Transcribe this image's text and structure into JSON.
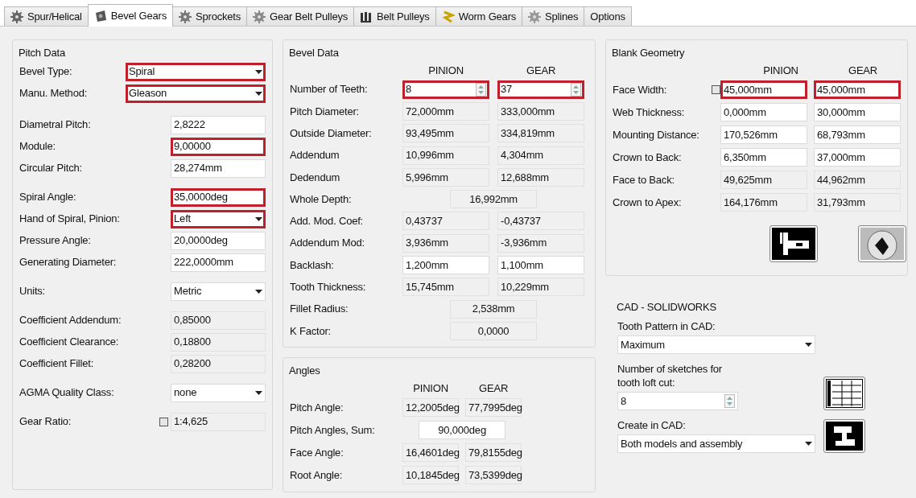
{
  "tabs": [
    {
      "label": "Spur/Helical",
      "selected": false
    },
    {
      "label": "Bevel Gears",
      "selected": true
    },
    {
      "label": "Sprockets",
      "selected": false
    },
    {
      "label": "Gear Belt Pulleys",
      "selected": false
    },
    {
      "label": "Belt Pulleys",
      "selected": false
    },
    {
      "label": "Worm Gears",
      "selected": false
    },
    {
      "label": "Splines",
      "selected": false
    },
    {
      "label": "Options",
      "selected": false
    }
  ],
  "pitch_data": {
    "title": "Pitch Data",
    "sections": [
      [
        {
          "label": "Bevel Type:",
          "field": {
            "kind": "dropdown",
            "value": "Spiral",
            "highlighted": true,
            "wide": true
          }
        },
        {
          "label": "Manu. Method:",
          "field": {
            "kind": "dropdown",
            "value": "Gleason",
            "highlighted": true,
            "wide": true
          }
        }
      ],
      [
        {
          "label": "Diametral Pitch:",
          "field": {
            "kind": "text",
            "value": "2,8222",
            "highlighted": false
          }
        },
        {
          "label": "Module:",
          "field": {
            "kind": "text",
            "value": "9,00000",
            "highlighted": true
          }
        },
        {
          "label": "Circular Pitch:",
          "field": {
            "kind": "text",
            "value": "28,274mm",
            "highlighted": false
          }
        }
      ],
      [
        {
          "label": "Spiral Angle:",
          "field": {
            "kind": "text",
            "value": "35,0000deg",
            "highlighted": true
          }
        },
        {
          "label": "Hand of Spiral, Pinion:",
          "field": {
            "kind": "dropdown",
            "value": "Left",
            "highlighted": true
          }
        },
        {
          "label": "Pressure Angle:",
          "field": {
            "kind": "text",
            "value": "20,0000deg",
            "highlighted": false
          }
        },
        {
          "label": "Generating Diameter:",
          "field": {
            "kind": "text",
            "value": "222,0000mm",
            "highlighted": false
          }
        }
      ],
      [
        {
          "label": "Units:",
          "field": {
            "kind": "dropdown",
            "value": "Metric",
            "highlighted": false
          }
        }
      ],
      [
        {
          "label": "Coefficient Addendum:",
          "field": {
            "kind": "readonly",
            "value": "0,85000",
            "highlighted": false
          }
        },
        {
          "label": "Coefficient Clearance:",
          "field": {
            "kind": "readonly",
            "value": "0,18800",
            "highlighted": false
          }
        },
        {
          "label": "Coefficient Fillet:",
          "field": {
            "kind": "readonly",
            "value": "0,28200",
            "highlighted": false
          }
        }
      ],
      [
        {
          "label": "AGMA Quality Class:",
          "field": {
            "kind": "dropdown",
            "value": "none",
            "highlighted": false
          }
        }
      ],
      [
        {
          "label": "Gear Ratio:",
          "checkbox": {
            "checked": false
          },
          "field": {
            "kind": "readonly",
            "value": "1:4,625",
            "highlighted": false
          }
        }
      ]
    ]
  },
  "bevel_data": {
    "title": "Bevel Data",
    "headers": [
      "PINION",
      "GEAR"
    ],
    "rows": [
      {
        "label": "Number of Teeth:",
        "cells": [
          {
            "kind": "spin",
            "value": "8",
            "highlighted": true
          },
          {
            "kind": "spin",
            "value": "37",
            "highlighted": true
          }
        ]
      },
      {
        "label": "Pitch Diameter:",
        "cells": [
          {
            "kind": "readonly",
            "value": "72,000mm",
            "highlighted": false
          },
          {
            "kind": "readonly",
            "value": "333,000mm",
            "highlighted": false
          }
        ]
      },
      {
        "label": "Outside Diameter:",
        "cells": [
          {
            "kind": "readonly",
            "value": "93,495mm",
            "highlighted": false
          },
          {
            "kind": "readonly",
            "value": "334,819mm",
            "highlighted": false
          }
        ]
      },
      {
        "label": "Addendum",
        "cells": [
          {
            "kind": "readonly",
            "value": "10,996mm",
            "highlighted": false
          },
          {
            "kind": "readonly",
            "value": "4,304mm",
            "highlighted": false
          }
        ]
      },
      {
        "label": "Dedendum",
        "cells": [
          {
            "kind": "readonly",
            "value": "5,996mm",
            "highlighted": false
          },
          {
            "kind": "readonly",
            "value": "12,688mm",
            "highlighted": false
          }
        ]
      },
      {
        "label": "Whole Depth:",
        "cells": [
          {
            "kind": "readonly",
            "value": "16,992mm",
            "highlighted": false
          }
        ]
      },
      {
        "label": "Add. Mod. Coef:",
        "cells": [
          {
            "kind": "readonly",
            "value": "0,43737",
            "highlighted": false
          },
          {
            "kind": "readonly",
            "value": "-0,43737",
            "highlighted": false
          }
        ]
      },
      {
        "label": "Addendum Mod:",
        "cells": [
          {
            "kind": "readonly",
            "value": "3,936mm",
            "highlighted": false
          },
          {
            "kind": "readonly",
            "value": "-3,936mm",
            "highlighted": false
          }
        ]
      },
      {
        "label": "Backlash:",
        "cells": [
          {
            "kind": "text",
            "value": "1,200mm",
            "highlighted": false
          },
          {
            "kind": "text",
            "value": "1,100mm",
            "highlighted": false
          }
        ]
      },
      {
        "label": "Tooth Thickness:",
        "cells": [
          {
            "kind": "readonly",
            "value": "15,745mm",
            "highlighted": false
          },
          {
            "kind": "readonly",
            "value": "10,229mm",
            "highlighted": false
          }
        ]
      },
      {
        "label": "Fillet Radius:",
        "cells": [
          {
            "kind": "readonly",
            "value": "2,538mm",
            "highlighted": false
          }
        ]
      },
      {
        "label": "K Factor:",
        "cells": [
          {
            "kind": "readonly",
            "value": "0,0000",
            "highlighted": false
          }
        ]
      }
    ]
  },
  "angles": {
    "title": "Angles",
    "headers": [
      "PINION",
      "GEAR"
    ],
    "rows": [
      {
        "label": "Pitch Angle:",
        "cells": [
          {
            "kind": "readonly",
            "value": "12,2005deg",
            "highlighted": false
          },
          {
            "kind": "readonly",
            "value": "77,7995deg",
            "highlighted": false
          }
        ]
      },
      {
        "label": "Pitch Angles, Sum:",
        "cells": [
          {
            "kind": "text",
            "value": "90,000deg",
            "highlighted": false
          }
        ]
      },
      {
        "label": "Face Angle:",
        "cells": [
          {
            "kind": "readonly",
            "value": "16,4601deg",
            "highlighted": false
          },
          {
            "kind": "readonly",
            "value": "79,8155deg",
            "highlighted": false
          }
        ]
      },
      {
        "label": "Root Angle:",
        "cells": [
          {
            "kind": "readonly",
            "value": "10,1845deg",
            "highlighted": false
          },
          {
            "kind": "readonly",
            "value": "73,5399deg",
            "highlighted": false
          }
        ]
      }
    ]
  },
  "blank_geometry": {
    "title": "Blank Geometry",
    "headers": [
      "PINION",
      "GEAR"
    ],
    "rows": [
      {
        "label": "Face Width:",
        "checkbox": {
          "checked": false
        },
        "cells": [
          {
            "kind": "text",
            "value": "45,000mm",
            "highlighted": true
          },
          {
            "kind": "text",
            "value": "45,000mm",
            "highlighted": true
          }
        ]
      },
      {
        "label": "Web Thickness:",
        "cells": [
          {
            "kind": "text",
            "value": "0,000mm",
            "highlighted": false
          },
          {
            "kind": "text",
            "value": "30,000mm",
            "highlighted": false
          }
        ]
      },
      {
        "label": "Mounting Distance:",
        "cells": [
          {
            "kind": "text",
            "value": "170,526mm",
            "highlighted": false
          },
          {
            "kind": "text",
            "value": "68,793mm",
            "highlighted": false
          }
        ]
      },
      {
        "label": "Crown to Back:",
        "cells": [
          {
            "kind": "text",
            "value": "6,350mm",
            "highlighted": false
          },
          {
            "kind": "text",
            "value": "37,000mm",
            "highlighted": false
          }
        ]
      },
      {
        "label": "Face to Back:",
        "cells": [
          {
            "kind": "readonly",
            "value": "49,625mm",
            "highlighted": false
          },
          {
            "kind": "readonly",
            "value": "44,962mm",
            "highlighted": false
          }
        ]
      },
      {
        "label": "Crown to Apex:",
        "cells": [
          {
            "kind": "readonly",
            "value": "164,176mm",
            "highlighted": false
          },
          {
            "kind": "readonly",
            "value": "31,793mm",
            "highlighted": false
          }
        ]
      }
    ]
  },
  "cad": {
    "title": "CAD - SOLIDWORKS",
    "items": [
      {
        "label": "Tooth Pattern in CAD:",
        "field": {
          "kind": "dropdown",
          "value": "Maximum",
          "highlighted": false
        }
      },
      {
        "label": "Number of sketches for tooth loft cut:",
        "field": {
          "kind": "spin",
          "value": "8",
          "highlighted": false
        }
      },
      {
        "label": "Create in CAD:",
        "field": {
          "kind": "dropdown",
          "value": "Both models and assembly",
          "highlighted": false
        }
      }
    ]
  }
}
